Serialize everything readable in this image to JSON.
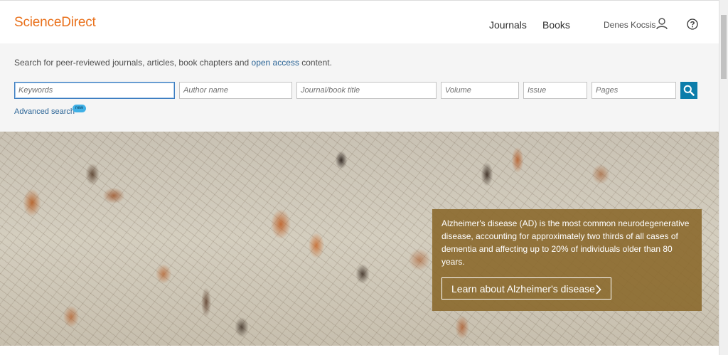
{
  "header": {
    "logo": "ScienceDirect",
    "nav": {
      "journals": "Journals",
      "books": "Books"
    },
    "user_name": "Denes Kocsis"
  },
  "search": {
    "intro_before": "Search for peer-reviewed journals, articles, book chapters and ",
    "intro_link": "open access",
    "intro_after": " content.",
    "fields": {
      "keywords": "Keywords",
      "author": "Author name",
      "journal": "Journal/book title",
      "volume": "Volume",
      "issue": "Issue",
      "pages": "Pages"
    },
    "advanced_label": "Advanced search",
    "new_badge": "new"
  },
  "hero": {
    "text": "Alzheimer's disease (AD) is the most common neurodegenerative disease, accounting for approximately two thirds of all cases of dementia and affecting up to 20% of individuals older than 80 years.",
    "button_label": "Learn about Alzheimer's disease"
  },
  "colors": {
    "brand": "#e9711c",
    "search_button": "#0c7daa",
    "link": "#2a6496",
    "callout": "#8b692c"
  },
  "icons": [
    "user-icon",
    "help-icon",
    "search-icon",
    "chevron-right-icon"
  ]
}
